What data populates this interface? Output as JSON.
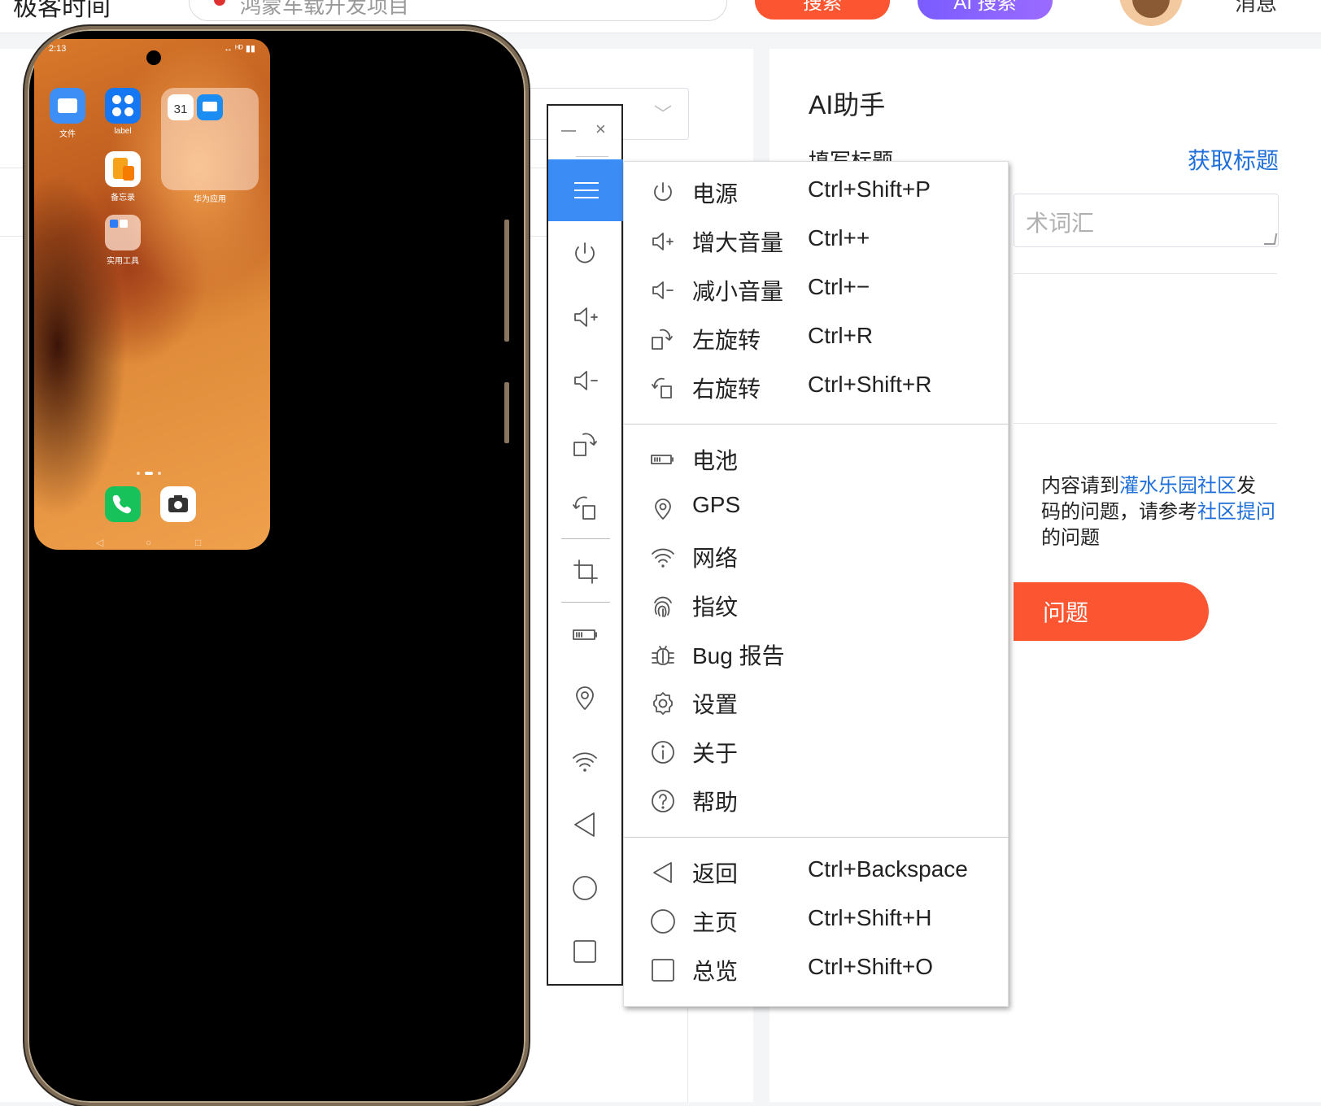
{
  "web": {
    "site_title": "极客时间",
    "search_placeholder": "鸿蒙车载开发项目",
    "search_button": "搜索",
    "ai_search_button": "AI 搜索",
    "messages": "消息"
  },
  "assistant": {
    "title": "AI助手",
    "fill_title": "填写标题",
    "get_title": "获取标题",
    "input_placeholder": "术词汇",
    "notice_line1_pre": "内容请到",
    "notice_line1_link": "灌水乐园社区",
    "notice_line1_post": "发",
    "notice_line2_pre": "码的问题，请参考",
    "notice_line2_link": "社区提问",
    "notice_line3": "的问题",
    "ask_button": "问题"
  },
  "phone": {
    "status_time": "2:13",
    "status_icons": "↔ ᴴᴰ ▮▮",
    "apps": [
      {
        "label": "文件"
      },
      {
        "label": "label"
      },
      {
        "label": "备忘录"
      },
      {
        "label": "实用工具"
      }
    ],
    "folder_label": "华为应用",
    "calendar_day": "31",
    "nav": {
      "back": "◁",
      "home": "○",
      "recent": "□"
    }
  },
  "toolbar": {
    "close": "×"
  },
  "menu": {
    "group1": [
      {
        "icon": "power-icon",
        "label": "电源",
        "shortcut": "Ctrl+Shift+P"
      },
      {
        "icon": "volume-up-icon",
        "label": "增大音量",
        "shortcut": "Ctrl++"
      },
      {
        "icon": "volume-down-icon",
        "label": "减小音量",
        "shortcut": "Ctrl+−"
      },
      {
        "icon": "rotate-left-icon",
        "label": "左旋转",
        "shortcut": "Ctrl+R"
      },
      {
        "icon": "rotate-right-icon",
        "label": "右旋转",
        "shortcut": "Ctrl+Shift+R"
      }
    ],
    "group2": [
      {
        "icon": "battery-icon",
        "label": "电池"
      },
      {
        "icon": "gps-icon",
        "label": "GPS"
      },
      {
        "icon": "wifi-icon",
        "label": "网络"
      },
      {
        "icon": "fingerprint-icon",
        "label": "指纹"
      },
      {
        "icon": "bug-icon",
        "label": "Bug 报告"
      },
      {
        "icon": "settings-icon",
        "label": "设置"
      },
      {
        "icon": "info-icon",
        "label": "关于"
      },
      {
        "icon": "help-icon",
        "label": "帮助"
      }
    ],
    "group3": [
      {
        "icon": "back-icon",
        "label": "返回",
        "shortcut": "Ctrl+Backspace"
      },
      {
        "icon": "home-icon",
        "label": "主页",
        "shortcut": "Ctrl+Shift+H"
      },
      {
        "icon": "overview-icon",
        "label": "总览",
        "shortcut": "Ctrl+Shift+O"
      }
    ]
  }
}
